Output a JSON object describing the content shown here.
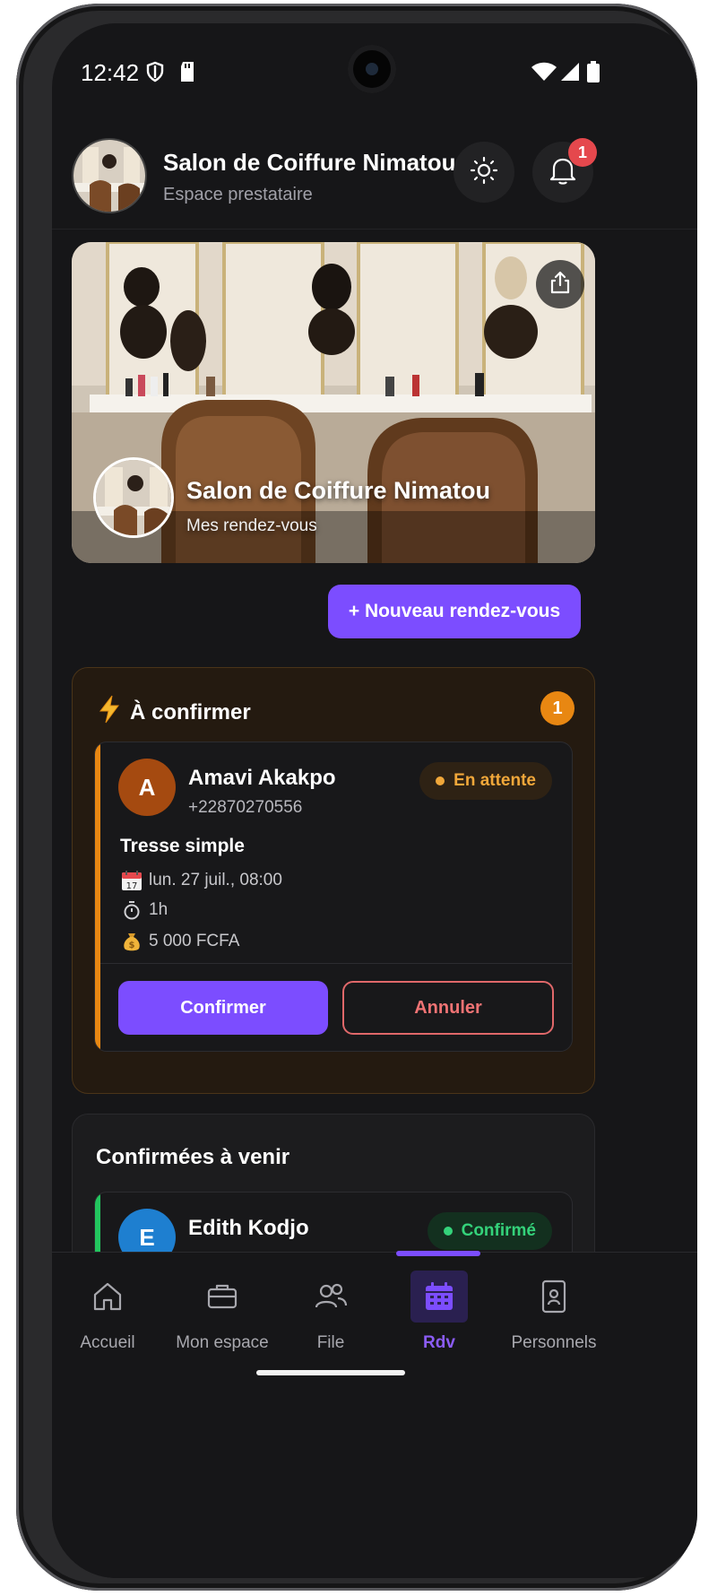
{
  "statusbar": {
    "time": "12:42"
  },
  "header": {
    "title": "Salon de Coiffure Nimatou",
    "subtitle": "Espace prestataire",
    "notification_count": "1"
  },
  "hero": {
    "title": "Salon de Coiffure Nimatou",
    "subtitle": "Mes rendez-vous"
  },
  "new_appointment_label": "+ Nouveau rendez-vous",
  "to_confirm": {
    "title": "À confirmer",
    "count": "1",
    "appointment": {
      "initial": "A",
      "name": "Amavi Akakpo",
      "phone": "+22870270556",
      "status": "En attente",
      "service": "Tresse simple",
      "date": "lun. 27 juil., 08:00",
      "duration": "1h",
      "price": "5 000 FCFA",
      "confirm_label": "Confirmer",
      "cancel_label": "Annuler"
    }
  },
  "upcoming": {
    "title": "Confirmées à venir",
    "appointment": {
      "initial": "E",
      "name": "Edith Kodjo",
      "phone": "+",
      "status": "Confirmé"
    }
  },
  "nav": [
    {
      "label": "Accueil",
      "icon": "home-icon"
    },
    {
      "label": "Mon espace",
      "icon": "briefcase-icon"
    },
    {
      "label": "File",
      "icon": "people-icon"
    },
    {
      "label": "Rdv",
      "icon": "calendar-icon",
      "active": true
    },
    {
      "label": "Personnels",
      "icon": "phone-card-icon"
    }
  ],
  "colors": {
    "accent": "#7c4dff",
    "pending": "#e88712",
    "confirmed": "#22c55e",
    "danger": "#e0686a"
  }
}
